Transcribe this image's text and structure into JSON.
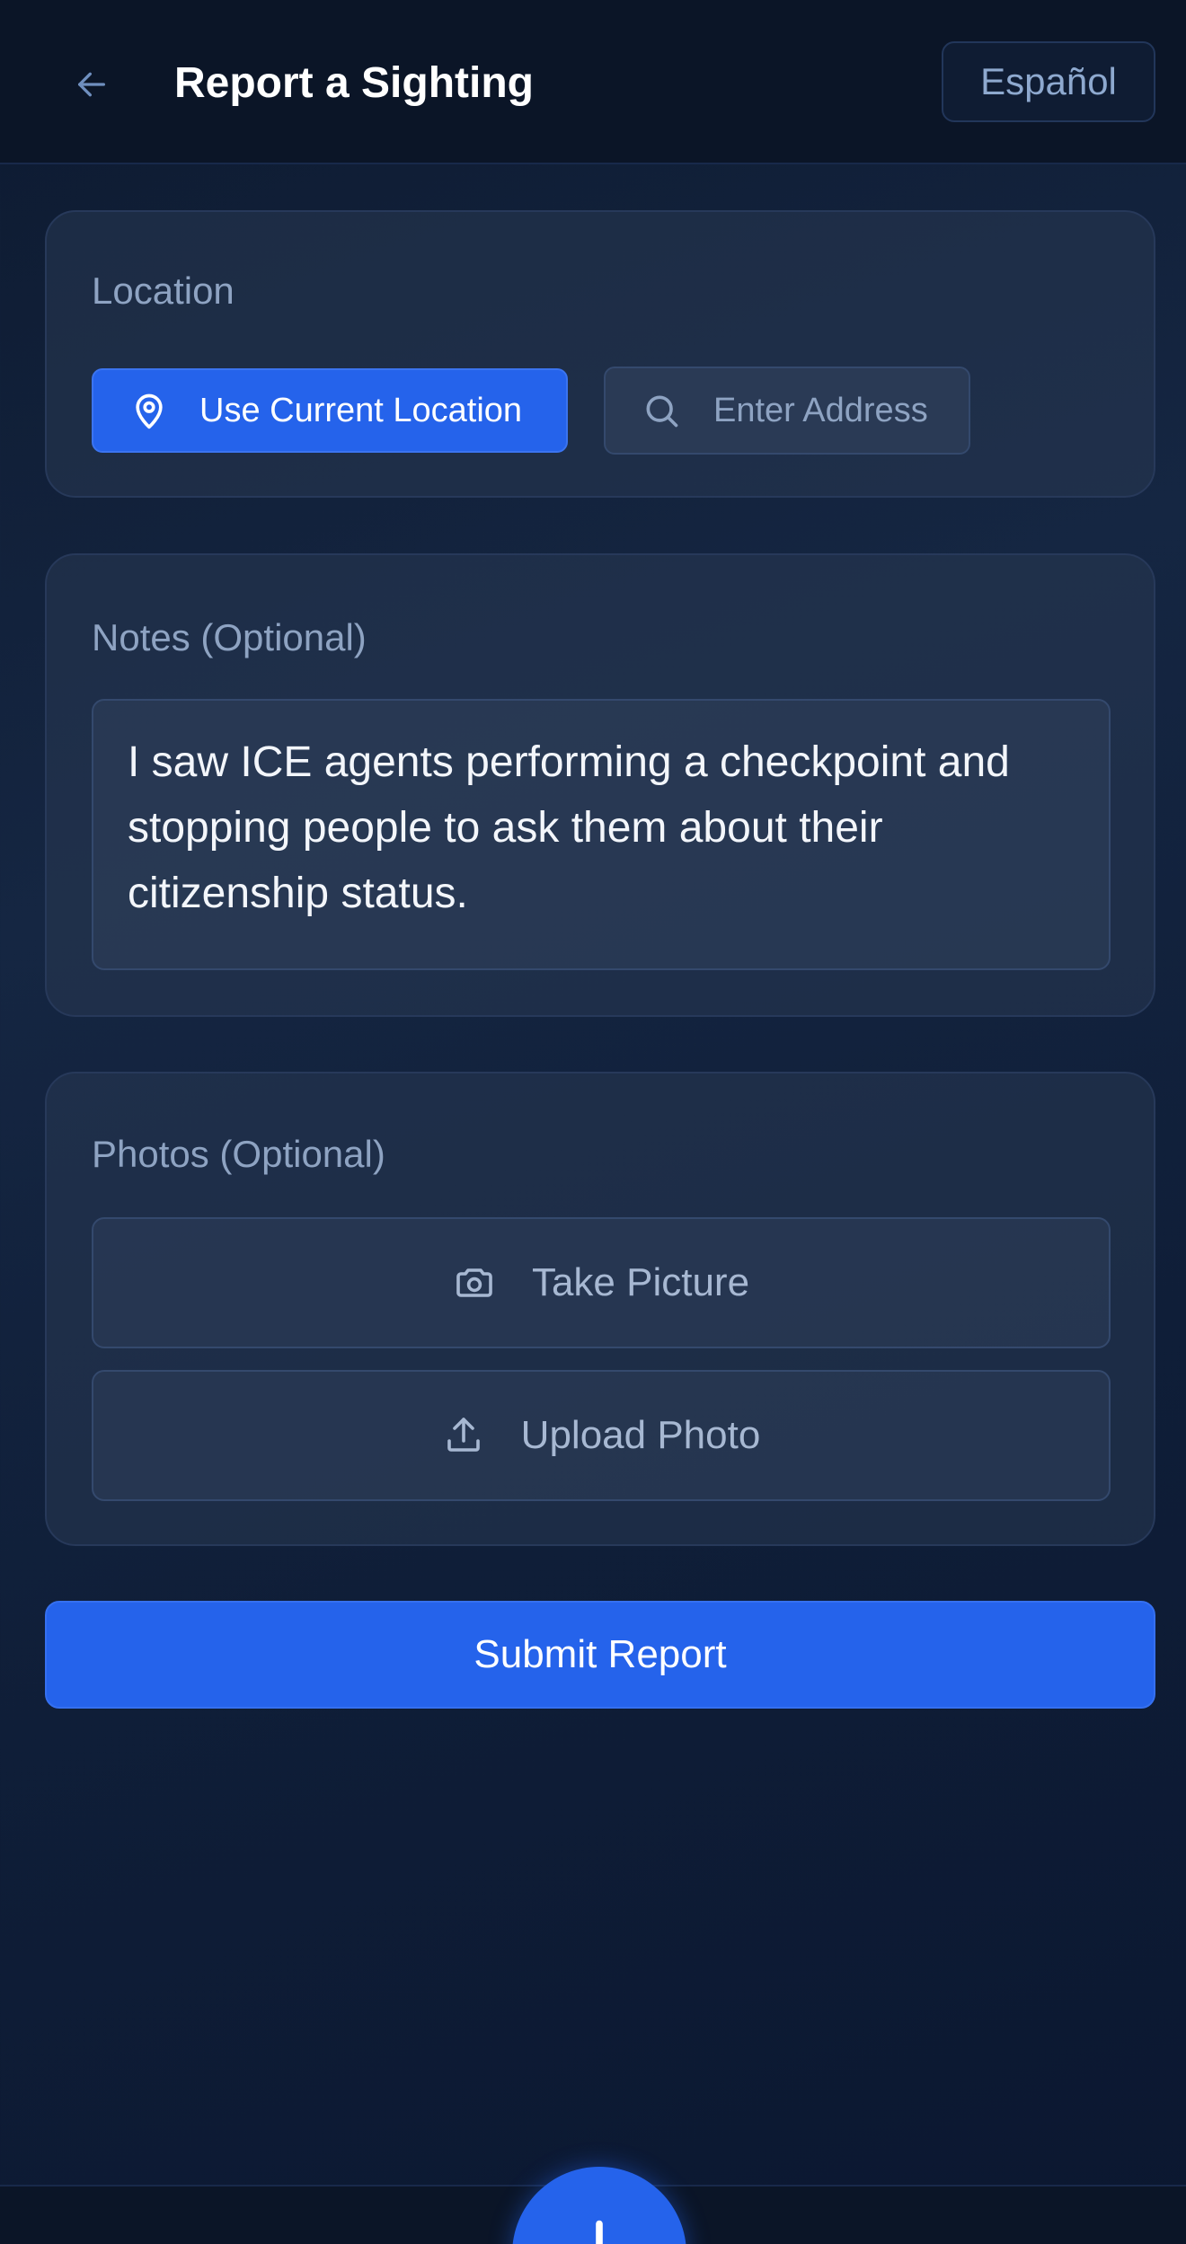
{
  "header": {
    "title": "Report a Sighting",
    "language_button": "Español"
  },
  "location": {
    "label": "Location",
    "current_button": "Use Current Location",
    "address_button": "Enter Address"
  },
  "notes": {
    "label": "Notes (Optional)",
    "value": "I saw ICE agents performing a checkpoint and stopping people to ask them about their citizenship status."
  },
  "photos": {
    "label": "Photos (Optional)",
    "take_button": "Take Picture",
    "upload_button": "Upload Photo"
  },
  "submit": {
    "label": "Submit Report"
  },
  "nav": {
    "icons": [
      "home-icon",
      "map-icon",
      "add-icon",
      "chat-icon",
      "heart-icon"
    ]
  },
  "colors": {
    "accent": "#2563eb",
    "background": "#0f1e38",
    "card": "#283852",
    "muted_text": "#8ea3c2"
  }
}
